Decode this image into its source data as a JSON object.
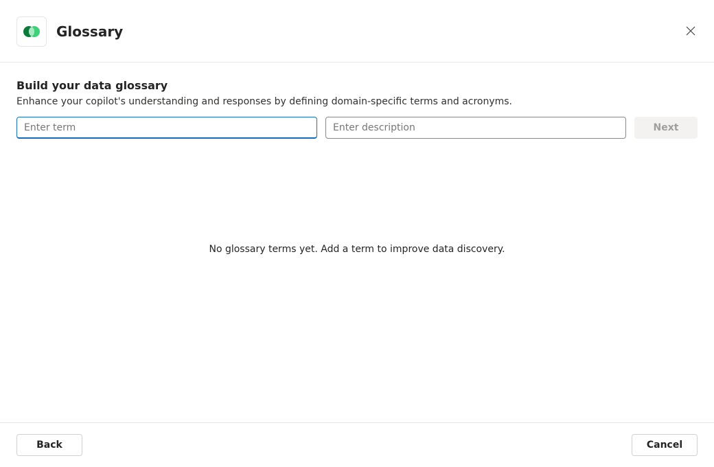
{
  "header": {
    "title": "Glossary"
  },
  "section": {
    "title": "Build your data glossary",
    "description": "Enhance your copilot's understanding and responses by defining domain-specific terms and acronyms."
  },
  "inputs": {
    "term_placeholder": "Enter term",
    "description_placeholder": "Enter description",
    "next_label": "Next"
  },
  "empty_state": "No glossary terms yet. Add a term to improve data discovery.",
  "footer": {
    "back_label": "Back",
    "cancel_label": "Cancel"
  },
  "colors": {
    "accent": "#0f6cbd",
    "logo_dark": "#0a7a3a",
    "logo_light": "#3fd07a"
  }
}
